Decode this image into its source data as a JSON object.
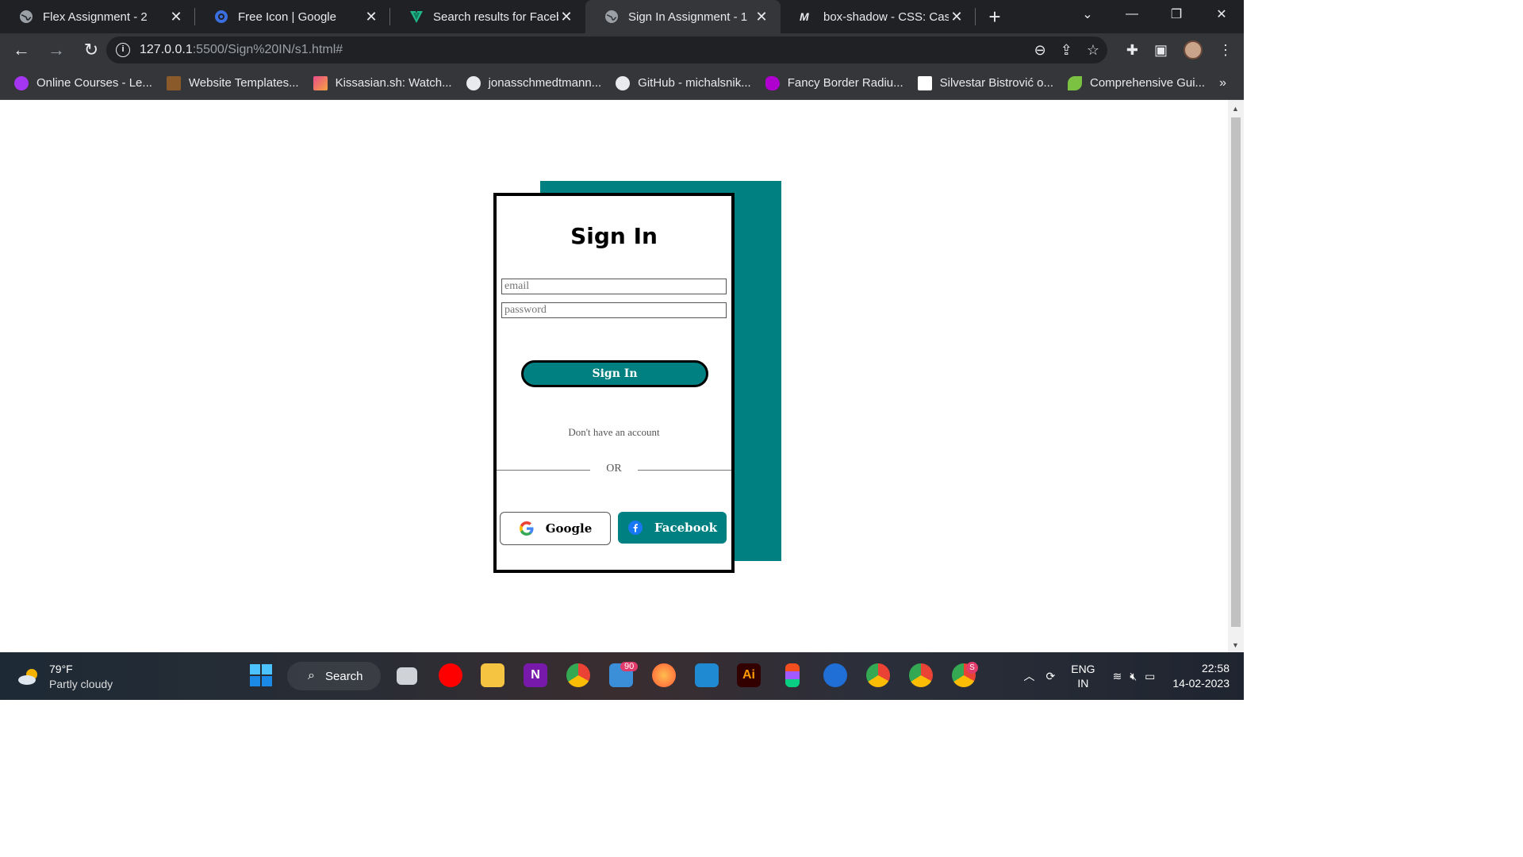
{
  "browser": {
    "tabs": [
      {
        "title": "Flex Assignment - 2",
        "icon": "globe-icon"
      },
      {
        "title": "Free Icon | Google",
        "icon": "flaticon-icon"
      },
      {
        "title": "Search results for Facebo",
        "icon": "vuetify-icon"
      },
      {
        "title": "Sign In Assignment - 1",
        "icon": "globe-icon",
        "active": true
      },
      {
        "title": "box-shadow - CSS: Cascac",
        "icon": "mdn-icon"
      }
    ],
    "url_host": "127.0.0.1",
    "url_rest": ":5500/Sign%20IN/s1.html#",
    "bookmarks": [
      "Online Courses - Le...",
      "Website Templates...",
      "Kissasian.sh: Watch...",
      "jonasschmedtmann...",
      "GitHub - michalsnik...",
      "Fancy Border Radiu...",
      "Silvestar Bistrović o...",
      "Comprehensive Gui..."
    ],
    "bookmarks_more": "»"
  },
  "signin": {
    "title": "Sign In",
    "email_placeholder": "email",
    "password_placeholder": "password",
    "button_label": "Sign In",
    "no_account_text": "Don't have an account",
    "or_text": "OR",
    "google_label": "Google",
    "facebook_label": "Facebook",
    "accent_color": "#008080"
  },
  "taskbar": {
    "temperature": "79°F",
    "condition": "Partly cloudy",
    "search_label": "Search",
    "mail_badge": "90",
    "chrome_badge": "S",
    "lang_top": "ENG",
    "lang_bottom": "IN",
    "time": "22:58",
    "date": "14-02-2023"
  }
}
